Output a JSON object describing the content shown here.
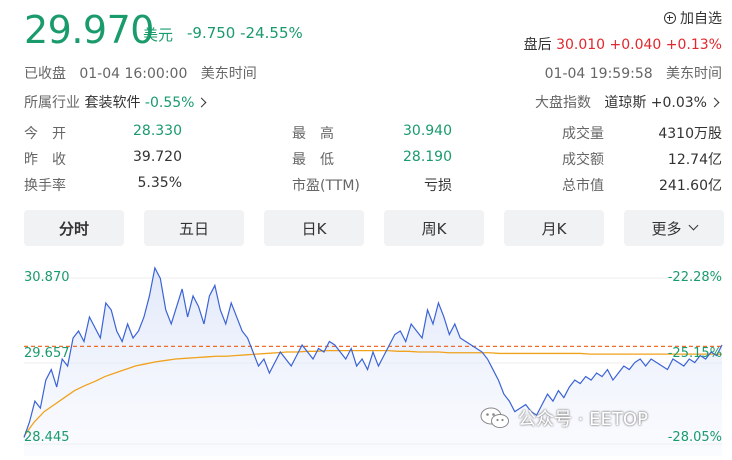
{
  "quote": {
    "price": "29.970",
    "currency": "美元",
    "change": "-9.750",
    "change_pct": "-24.55%",
    "add_watch": "加自选",
    "after_hours_label": "盘后",
    "after_hours_price": "30.010",
    "after_hours_change": "+0.040",
    "after_hours_pct": "+0.13%",
    "status": "已收盘",
    "close_time": "01-04 16:00:00",
    "close_tz": "美东时间",
    "ah_time": "01-04 19:59:58",
    "ah_tz": "美东时间"
  },
  "industry": {
    "label": "所属行业",
    "name": "套装软件",
    "pct": "-0.55%"
  },
  "index": {
    "label": "大盘指数",
    "name": "道琼斯",
    "pct": "+0.03%"
  },
  "stats": {
    "open_label": "今　开",
    "open": "28.330",
    "prev_label": "昨　收",
    "prev": "39.720",
    "turnover_label": "换手率",
    "turnover": "5.35%",
    "high_label": "最　高",
    "high": "30.940",
    "low_label": "最　低",
    "low": "28.190",
    "pe_label": "市盈(TTM)",
    "pe": "亏损",
    "volume_label": "成交量",
    "volume": "4310万股",
    "amount_label": "成交额",
    "amount": "12.74亿",
    "mcap_label": "总市值",
    "mcap": "241.60亿"
  },
  "tabs": [
    "分时",
    "五日",
    "日K",
    "周K",
    "月K",
    "更多"
  ],
  "colors": {
    "up": "#e0282d",
    "down": "#1a9b6c",
    "price_line": "#3b63d6",
    "avg_line": "#f0a21c",
    "ref_line": "#f36b2a"
  },
  "chart_data": {
    "type": "line",
    "y_labels_left": [
      "30.870",
      "29.657",
      "28.445"
    ],
    "y_labels_right": [
      "-22.28%",
      "-25.15%",
      "-28.05%"
    ],
    "ylim": [
      28.445,
      30.87
    ],
    "reference_price": 29.78,
    "series": [
      {
        "values": [
          28.48,
          28.7,
          29.0,
          28.9,
          29.3,
          29.45,
          29.2,
          29.6,
          29.5,
          29.9,
          30.0,
          29.85,
          30.2,
          30.05,
          29.9,
          30.4,
          30.3,
          30.0,
          29.85,
          30.1,
          29.9,
          30.0,
          30.2,
          30.5,
          30.9,
          30.75,
          30.3,
          30.1,
          30.35,
          30.6,
          30.2,
          30.5,
          30.35,
          30.1,
          30.5,
          30.65,
          30.3,
          30.1,
          30.4,
          30.2,
          30.0,
          29.9,
          29.7,
          29.5,
          29.6,
          29.4,
          29.55,
          29.7,
          29.6,
          29.5,
          29.65,
          29.8,
          29.7,
          29.6,
          29.75,
          29.7,
          29.85,
          29.8,
          29.7,
          29.6,
          29.75,
          29.5,
          29.6,
          29.45,
          29.7,
          29.5,
          29.65,
          29.8,
          29.95,
          30.0,
          29.85,
          30.1,
          30.0,
          29.9,
          30.3,
          30.1,
          30.4,
          30.2,
          29.95,
          30.1,
          29.9,
          29.85,
          29.8,
          29.75,
          29.7,
          29.6,
          29.45,
          29.3,
          29.1,
          29.0,
          28.85,
          28.9,
          28.95,
          28.85,
          28.8,
          28.95,
          29.1,
          29.0,
          29.15,
          29.05,
          29.2,
          29.3,
          29.25,
          29.35,
          29.3,
          29.4,
          29.35,
          29.45,
          29.3,
          29.4,
          29.5,
          29.45,
          29.55,
          29.6,
          29.5,
          29.6,
          29.55,
          29.5,
          29.45,
          29.6,
          29.55,
          29.5,
          29.6,
          29.55,
          29.65,
          29.6,
          29.7,
          29.65,
          29.8
        ],
        "color": "#3b63d6"
      },
      {
        "values": [
          28.5,
          28.7,
          28.85,
          28.95,
          29.05,
          29.15,
          29.22,
          29.28,
          29.35,
          29.4,
          29.45,
          29.5,
          29.53,
          29.56,
          29.58,
          29.6,
          29.61,
          29.62,
          29.63,
          29.64,
          29.64,
          29.65,
          29.66,
          29.67,
          29.68,
          29.69,
          29.7,
          29.7,
          29.71,
          29.71,
          29.72,
          29.72,
          29.72,
          29.72,
          29.72,
          29.72,
          29.72,
          29.71,
          29.71,
          29.7,
          29.7,
          29.7,
          29.69,
          29.69,
          29.69,
          29.69,
          29.69,
          29.68,
          29.68,
          29.68,
          29.68,
          29.68,
          29.68,
          29.68,
          29.68,
          29.68,
          29.67,
          29.67,
          29.67,
          29.67,
          29.67,
          29.67,
          29.67,
          29.67,
          29.67,
          29.67,
          29.67,
          29.67,
          29.67,
          29.67
        ],
        "color": "#f0a21c"
      }
    ]
  },
  "watermark": "公众号 · EETOP"
}
